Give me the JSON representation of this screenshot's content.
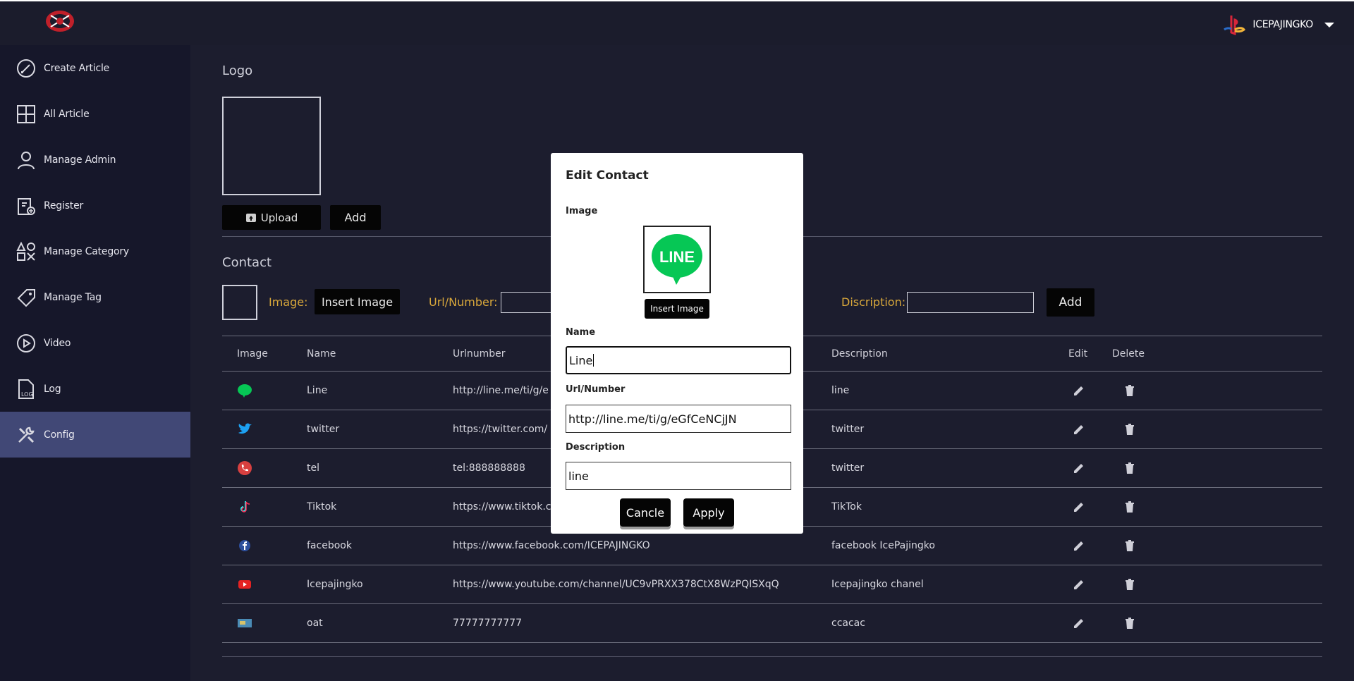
{
  "header": {
    "username": "ICEPAJINGKO"
  },
  "sidebar": {
    "items": [
      {
        "label": "Create Article",
        "icon": "pencil-circle-icon"
      },
      {
        "label": "All Article",
        "icon": "grid-icon"
      },
      {
        "label": "Manage Admin",
        "icon": "person-icon"
      },
      {
        "label": "Register",
        "icon": "clipboard-add-icon"
      },
      {
        "label": "Manage Category",
        "icon": "shapes-icon"
      },
      {
        "label": "Manage Tag",
        "icon": "tag-icon"
      },
      {
        "label": "Video",
        "icon": "play-circle-icon"
      },
      {
        "label": "Log",
        "icon": "log-file-icon"
      },
      {
        "label": "Config",
        "icon": "tools-icon",
        "active": true
      }
    ]
  },
  "logo_section": {
    "title": "Logo",
    "upload_label": "Upload",
    "add_label": "Add"
  },
  "contact_section": {
    "title": "Contact",
    "image_label": "Image:",
    "insert_image_label": "Insert Image",
    "url_label": "Url/Number:",
    "description_label": "Discription:",
    "add_label": "Add"
  },
  "table": {
    "headers": {
      "image": "Image",
      "name": "Name",
      "url": "Urlnumber",
      "description": "Description",
      "edit": "Edit",
      "delete": "Delete"
    },
    "rows": [
      {
        "icon": "line-icon",
        "name": "Line",
        "url": "http://line.me/ti/g/e",
        "description": "line"
      },
      {
        "icon": "twitter-icon",
        "name": "twitter",
        "url": "https://twitter.com/",
        "description": "twitter"
      },
      {
        "icon": "phone-icon",
        "name": "tel",
        "url": "tel:888888888",
        "description": "twitter"
      },
      {
        "icon": "tiktok-icon",
        "name": "Tiktok",
        "url": "https://www.tiktok.c",
        "description": "TikTok"
      },
      {
        "icon": "facebook-icon",
        "name": "facebook",
        "url": "https://www.facebook.com/ICEPAJINGKO",
        "description": "facebook IcePajingko"
      },
      {
        "icon": "youtube-icon",
        "name": "Icepajingko",
        "url": "https://www.youtube.com/channel/UC9vPRXX378CtX8WzPQISXqQ",
        "description": "Icepajingko chanel"
      },
      {
        "icon": "card-icon",
        "name": "oat",
        "url": "77777777777",
        "description": "ccacac"
      }
    ]
  },
  "modal": {
    "title": "Edit Contact",
    "image_label": "Image",
    "logo_text": "LINE",
    "insert_image_label": "Insert Image",
    "name_label": "Name",
    "name_value": "Line",
    "url_label": "Url/Number",
    "url_value": "http://line.me/ti/g/eGfCeNCjJN",
    "description_label": "Description",
    "description_value": "line",
    "cancel_label": "Cancle",
    "apply_label": "Apply"
  },
  "colors": {
    "background": "#1c1d2e",
    "sidebar": "#16172a",
    "active": "#414876",
    "accent_label": "#d9a83b",
    "line_green": "#06c755"
  }
}
